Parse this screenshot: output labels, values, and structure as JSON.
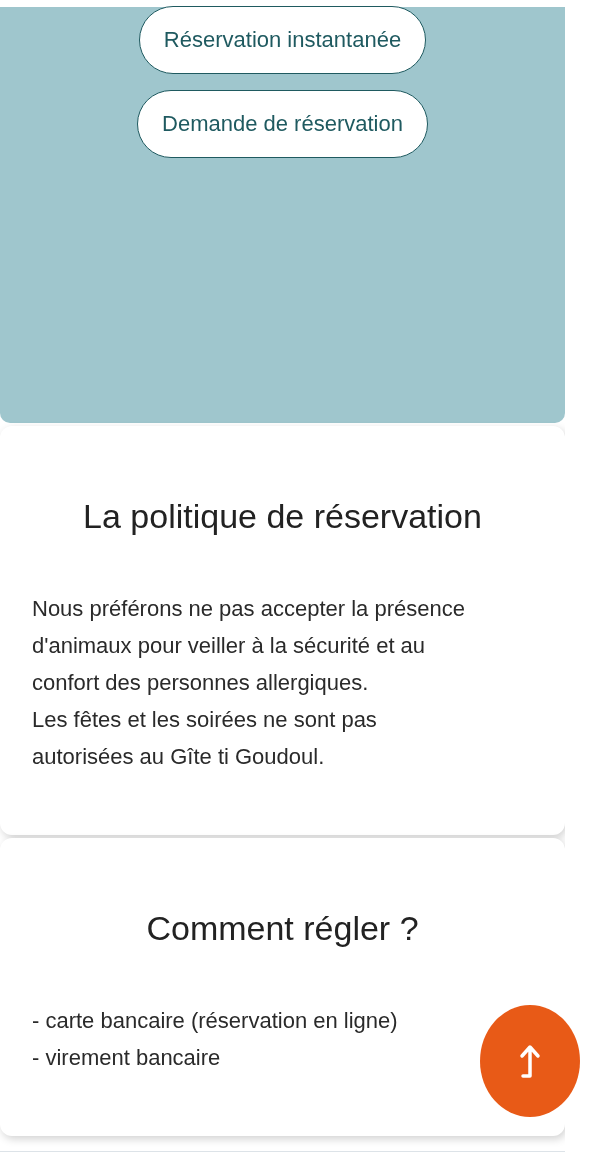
{
  "booking_buttons": [
    {
      "label": "Réservation instantanée"
    },
    {
      "label": "Demande de réservation"
    }
  ],
  "sections": [
    {
      "title": "La politique de réservation",
      "paragraphs": [
        "Nous préférons ne pas accepter la présence d'animaux pour veiller à la sécurité et au confort des personnes allergiques.",
        "Les fêtes et les soirées ne sont pas autorisées au Gîte ti Goudoul."
      ]
    },
    {
      "title": "Comment régler ?",
      "paragraphs": [
        "- carte bancaire (réservation en ligne)",
        "- virement bancaire"
      ]
    }
  ]
}
